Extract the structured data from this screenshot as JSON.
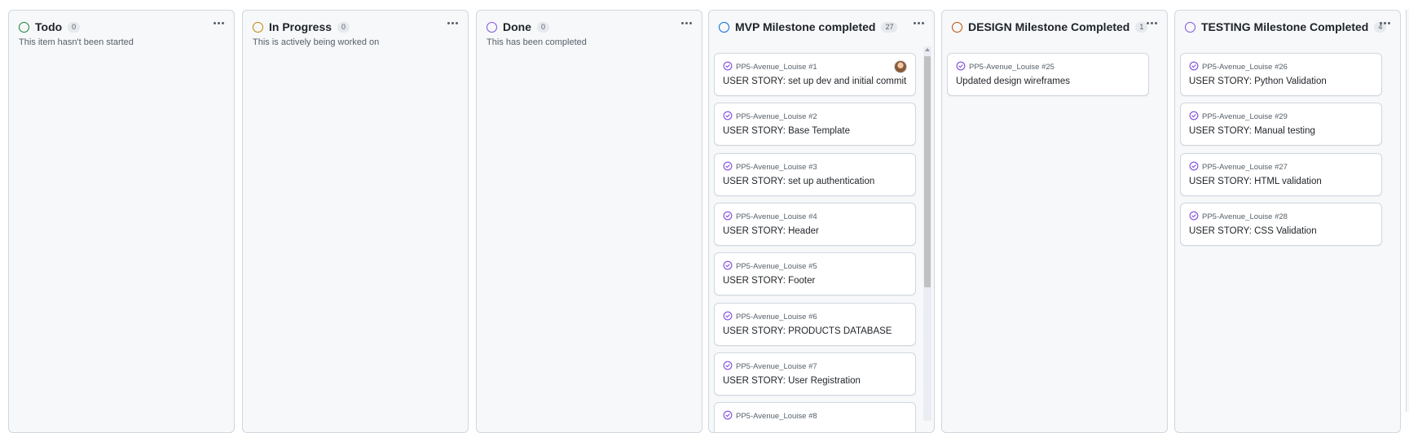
{
  "columns": [
    {
      "title": "Todo",
      "count": "0",
      "status_color": "#1a7f37",
      "description": "This item hasn't been started",
      "cards": []
    },
    {
      "title": "In Progress",
      "count": "0",
      "status_color": "#bf8700",
      "description": "This is actively being worked on",
      "cards": []
    },
    {
      "title": "Done",
      "count": "0",
      "status_color": "#8250df",
      "description": "This has been completed",
      "cards": []
    },
    {
      "title": "MVP Milestone completed",
      "count": "27",
      "status_color": "#0969da",
      "description": "",
      "cards": [
        {
          "ref": "PP5-Avenue_Louise #1",
          "title": "USER STORY: set up dev and initial commit",
          "avatar": true
        },
        {
          "ref": "PP5-Avenue_Louise #2",
          "title": "USER STORY: Base Template"
        },
        {
          "ref": "PP5-Avenue_Louise #3",
          "title": "USER STORY: set up authentication"
        },
        {
          "ref": "PP5-Avenue_Louise #4",
          "title": "USER STORY: Header"
        },
        {
          "ref": "PP5-Avenue_Louise #5",
          "title": "USER STORY: Footer"
        },
        {
          "ref": "PP5-Avenue_Louise #6",
          "title": "USER STORY: PRODUCTS DATABASE"
        },
        {
          "ref": "PP5-Avenue_Louise #7",
          "title": "USER STORY: User Registration"
        },
        {
          "ref": "PP5-Avenue_Louise #8",
          "title": ""
        }
      ]
    },
    {
      "title": "DESIGN Milestone Completed",
      "count": "1",
      "status_color": "#bc4c00",
      "description": "",
      "cards": [
        {
          "ref": "PP5-Avenue_Louise #25",
          "title": "Updated design wireframes"
        }
      ]
    },
    {
      "title": "TESTING Milestone Completed",
      "count": "4",
      "status_color": "#8250df",
      "description": "",
      "cards": [
        {
          "ref": "PP5-Avenue_Louise #26",
          "title": "USER STORY: Python Validation"
        },
        {
          "ref": "PP5-Avenue_Louise #29",
          "title": "USER STORY: Manual testing"
        },
        {
          "ref": "PP5-Avenue_Louise #27",
          "title": "USER STORY: HTML validation"
        },
        {
          "ref": "PP5-Avenue_Louise #28",
          "title": "USER STORY: CSS Validation"
        }
      ]
    }
  ],
  "icons": {
    "column_menu": "kebab-horizontal-icon",
    "issue_closed": "issue-closed-icon",
    "avatar": "user-avatar"
  },
  "colors": {
    "issue_closed": "#8250df"
  }
}
